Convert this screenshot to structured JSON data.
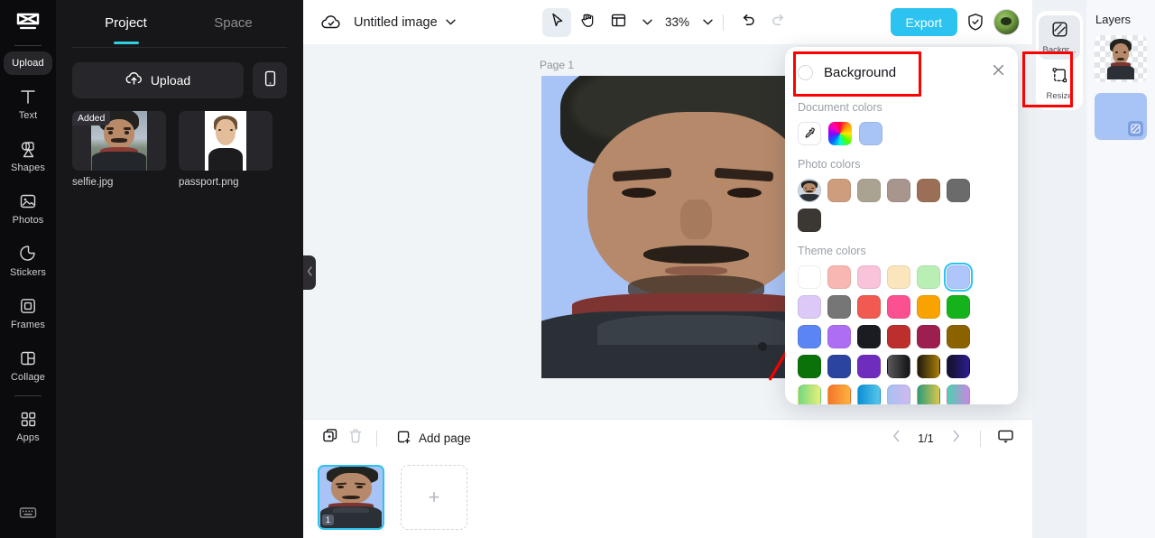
{
  "app": {
    "logo_icon": "capcut-logo-icon"
  },
  "rail": {
    "items": [
      {
        "label": "Upload",
        "icon": "upload-icon",
        "active": true
      },
      {
        "label": "Text",
        "icon": "text-icon",
        "active": false
      },
      {
        "label": "Shapes",
        "icon": "shapes-icon",
        "active": false
      },
      {
        "label": "Photos",
        "icon": "photos-icon",
        "active": false
      },
      {
        "label": "Stickers",
        "icon": "sticker-icon",
        "active": false
      },
      {
        "label": "Frames",
        "icon": "frames-icon",
        "active": false
      },
      {
        "label": "Collage",
        "icon": "collage-icon",
        "active": false
      },
      {
        "label": "Apps",
        "icon": "apps-grid-icon",
        "active": false
      }
    ],
    "bottom_icon": "keyboard-icon"
  },
  "panel": {
    "tabs": [
      {
        "label": "Project",
        "active": true
      },
      {
        "label": "Space",
        "active": false
      }
    ],
    "upload_label": "Upload",
    "upload_icon": "cloud-upload-icon",
    "phone_icon": "mobile-phone-icon",
    "assets": [
      {
        "name": "selfie.jpg",
        "badge": "Added"
      },
      {
        "name": "passport.png",
        "badge": ""
      }
    ],
    "collapse_icon": "chevron-left-icon"
  },
  "topbar": {
    "cloud_icon": "cloud-saved-icon",
    "doc_title": "Untitled image",
    "title_chevron": "chevron-down-icon",
    "tools": [
      {
        "name": "select-tool",
        "icon": "cursor-arrow-icon",
        "selected": true
      },
      {
        "name": "hand-tool",
        "icon": "hand-icon",
        "selected": false
      },
      {
        "name": "layout-tool",
        "icon": "layout-panel-icon",
        "selected": false
      }
    ],
    "zoom_value": "33%",
    "undo_icon": "undo-arrow-icon",
    "redo_icon": "redo-arrow-icon",
    "export_label": "Export",
    "shield_icon": "shield-check-icon",
    "avatar_name": "user-avatar"
  },
  "canvas": {
    "page_label": "Page 1",
    "artboard_background": "#a8c3f5",
    "annotation_arrow_color": "#ff0000"
  },
  "bottombar": {
    "duplicate_icon": "duplicate-page-icon",
    "delete_icon": "trash-icon",
    "add_page_label": "Add page",
    "add_page_icon": "add-page-icon",
    "prev_icon": "chevron-left-icon",
    "page_indicator": "1/1",
    "next_icon": "chevron-right-icon",
    "present_icon": "present-screen-icon"
  },
  "pagestrip": {
    "page_badge": "1",
    "add_glyph": "+"
  },
  "right_rail": {
    "items": [
      {
        "label": "Backgr...",
        "icon": "background-fill-icon",
        "active": true
      },
      {
        "label": "Resize",
        "icon": "resize-frame-icon",
        "active": false
      }
    ]
  },
  "layers": {
    "title": "Layers",
    "items": [
      {
        "name": "layer-photo",
        "type": "photo"
      },
      {
        "name": "layer-background",
        "type": "background",
        "color": "#a8c3f5"
      }
    ]
  },
  "background_popover": {
    "title": "Background",
    "close_icon": "close-x-icon",
    "sections": [
      {
        "label": "Document colors",
        "swatches": [
          {
            "type": "picker",
            "name": "eyedropper-icon",
            "color": "#ffffff"
          },
          {
            "type": "rainbow",
            "name": "color-wheel",
            "color": "#ff4d94"
          },
          {
            "type": "solid",
            "name": "doc-color-blue",
            "color": "#a8c3f5"
          }
        ]
      },
      {
        "label": "Photo colors",
        "swatches": [
          {
            "type": "photo",
            "name": "photo-source-thumb",
            "color": "#b6896a"
          },
          {
            "type": "solid",
            "name": "photo-color-1",
            "color": "#ce9d7e"
          },
          {
            "type": "solid",
            "name": "photo-color-2",
            "color": "#aba392"
          },
          {
            "type": "solid",
            "name": "photo-color-3",
            "color": "#a8958e"
          },
          {
            "type": "solid",
            "name": "photo-color-4",
            "color": "#9a6f56"
          },
          {
            "type": "solid",
            "name": "photo-color-5",
            "color": "#6b6b6b"
          },
          {
            "type": "solid",
            "name": "photo-color-6",
            "color": "#3b3733"
          }
        ]
      },
      {
        "label": "Theme colors",
        "swatches": [
          {
            "type": "solid",
            "name": "theme-white",
            "color": "#ffffff",
            "selected": false
          },
          {
            "type": "solid",
            "name": "theme-salmon",
            "color": "#f9b7b2",
            "selected": false
          },
          {
            "type": "solid",
            "name": "theme-pink-light",
            "color": "#f9c3da",
            "selected": false
          },
          {
            "type": "solid",
            "name": "theme-cream",
            "color": "#fae5bc",
            "selected": false
          },
          {
            "type": "solid",
            "name": "theme-mint",
            "color": "#b9efb4",
            "selected": false
          },
          {
            "type": "solid",
            "name": "theme-periwinkle",
            "color": "#aec6fb",
            "selected": true
          },
          {
            "type": "solid",
            "name": "theme-lavender",
            "color": "#ddc9f7",
            "selected": false
          },
          {
            "type": "solid",
            "name": "theme-gray",
            "color": "#767676",
            "selected": false
          },
          {
            "type": "solid",
            "name": "theme-red-coral",
            "color": "#f05a50",
            "selected": false
          },
          {
            "type": "solid",
            "name": "theme-hot-pink",
            "color": "#fb5192",
            "selected": false
          },
          {
            "type": "solid",
            "name": "theme-orange",
            "color": "#f8a300",
            "selected": false
          },
          {
            "type": "solid",
            "name": "theme-green",
            "color": "#16b21b",
            "selected": false
          },
          {
            "type": "solid",
            "name": "theme-blue",
            "color": "#5b85f5",
            "selected": false
          },
          {
            "type": "solid",
            "name": "theme-purple-lt",
            "color": "#ae6ef3",
            "selected": false
          },
          {
            "type": "solid",
            "name": "theme-near-black",
            "color": "#1b1c21",
            "selected": false
          },
          {
            "type": "solid",
            "name": "theme-brick",
            "color": "#bc2f2c",
            "selected": false
          },
          {
            "type": "solid",
            "name": "theme-maroon",
            "color": "#9c1f4f",
            "selected": false
          },
          {
            "type": "solid",
            "name": "theme-olive-gold",
            "color": "#8a6200",
            "selected": false
          },
          {
            "type": "solid",
            "name": "theme-dark-green",
            "color": "#0b7209",
            "selected": false
          },
          {
            "type": "solid",
            "name": "theme-navy",
            "color": "#2b44a0",
            "selected": false
          },
          {
            "type": "solid",
            "name": "theme-violet",
            "color": "#6f2dbd",
            "selected": false
          },
          {
            "type": "grad",
            "name": "theme-grad-black",
            "color": "linear-gradient(90deg,#59595c,#131316)",
            "selected": false
          },
          {
            "type": "grad",
            "name": "theme-grad-gold",
            "color": "linear-gradient(90deg,#1f1a0c,#a87d0a)",
            "selected": false
          },
          {
            "type": "grad",
            "name": "theme-grad-indigo",
            "color": "linear-gradient(90deg,#121126,#2b1d8f)",
            "selected": false
          },
          {
            "type": "grad",
            "name": "theme-grad-green-yellow",
            "color": "linear-gradient(90deg,#74d87e,#e9ef7a)",
            "selected": false
          },
          {
            "type": "grad",
            "name": "theme-grad-orange",
            "color": "linear-gradient(90deg,#f4752b,#fbb23e)",
            "selected": false
          },
          {
            "type": "grad",
            "name": "theme-grad-blue",
            "color": "linear-gradient(90deg,#0c8fd6,#57c7e8)",
            "selected": false
          },
          {
            "type": "grad",
            "name": "theme-grad-lavender",
            "color": "linear-gradient(90deg,#a9c0f2,#ceb9ef)",
            "selected": false
          },
          {
            "type": "grad",
            "name": "theme-grad-teal-gold",
            "color": "linear-gradient(90deg,#2f9b7a,#d9c64a)",
            "selected": false
          },
          {
            "type": "grad",
            "name": "theme-grad-mint-pink",
            "color": "linear-gradient(90deg,#4fd0b0,#c887e0)",
            "selected": false
          }
        ]
      }
    ]
  }
}
